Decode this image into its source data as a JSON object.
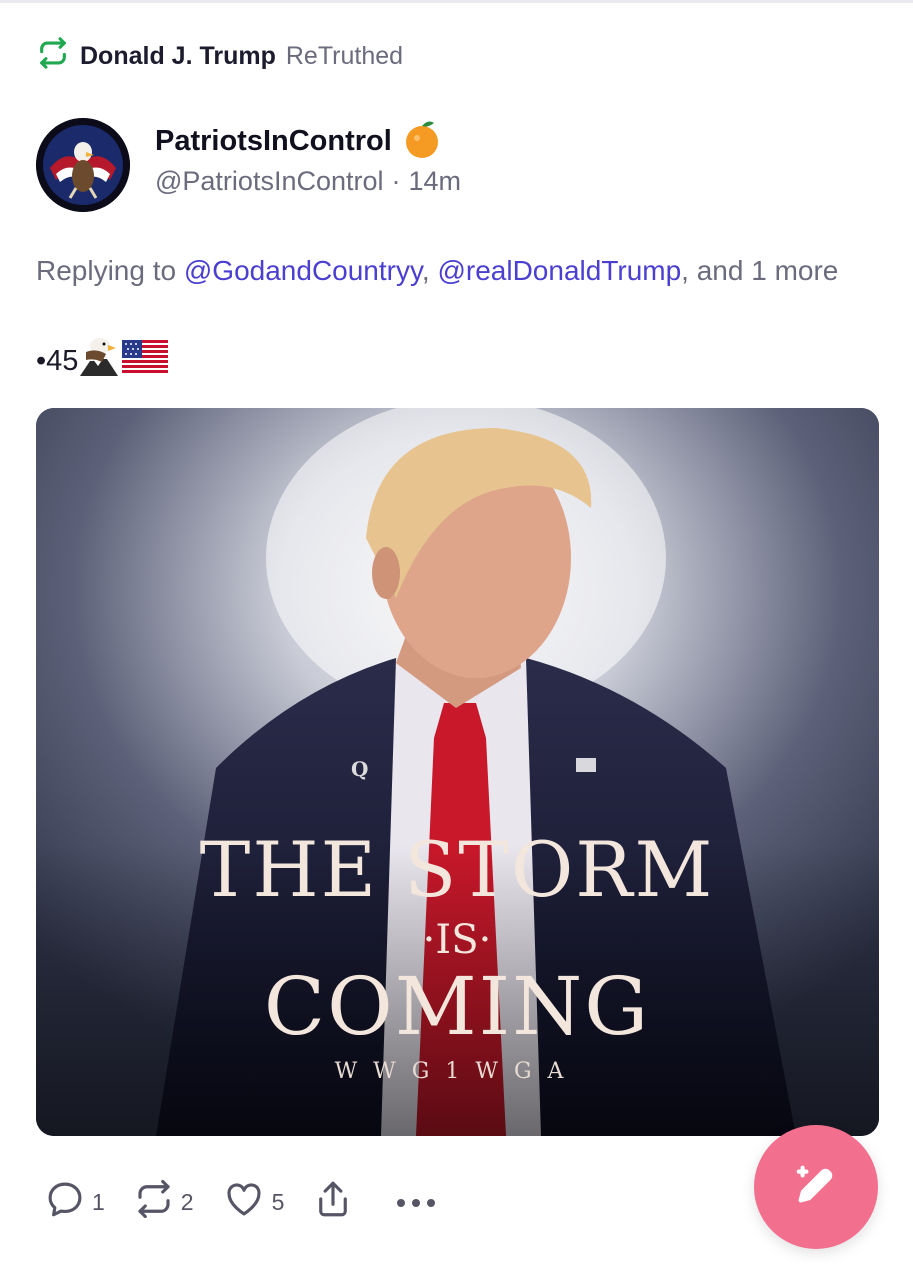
{
  "retruth": {
    "user": "Donald J. Trump",
    "action": "ReTruthed"
  },
  "post": {
    "display_name": "PatriotsInControl",
    "handle": "@PatriotsInControl",
    "separator": "·",
    "time": "14m",
    "reply_prefix": "Replying to",
    "mentions": [
      "@GodandCountryy",
      "@realDonaldTrump"
    ],
    "reply_suffix": ", and",
    "reply_more": "1 more",
    "text": "•45",
    "image": {
      "lines": [
        "THE STORM",
        "·IS·",
        "COMING",
        "WWG1WGA"
      ],
      "lapel": "Q"
    }
  },
  "actions": {
    "replies": "1",
    "retruths": "2",
    "likes": "5"
  },
  "colors": {
    "accent": "#4a3fd0",
    "retruth_icon": "#1fa84f",
    "fab": "#f26f8e",
    "muted": "#6b6b7e"
  },
  "icons": [
    "retruth-icon",
    "orange-badge-icon",
    "eagle-emoji-icon",
    "us-flag-emoji-icon",
    "reply-icon",
    "share-icon",
    "more-icon",
    "compose-icon"
  ]
}
